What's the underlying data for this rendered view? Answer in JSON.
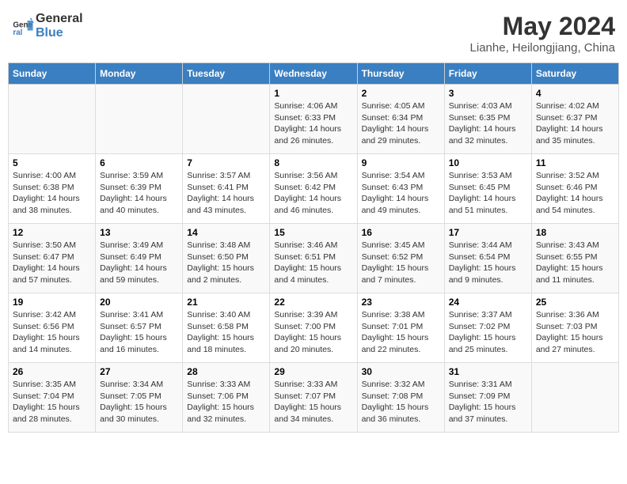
{
  "logo": {
    "line1": "General",
    "line2": "Blue"
  },
  "title": "May 2024",
  "subtitle": "Lianhe, Heilongjiang, China",
  "days_of_week": [
    "Sunday",
    "Monday",
    "Tuesday",
    "Wednesday",
    "Thursday",
    "Friday",
    "Saturday"
  ],
  "weeks": [
    [
      {
        "day": "",
        "info": ""
      },
      {
        "day": "",
        "info": ""
      },
      {
        "day": "",
        "info": ""
      },
      {
        "day": "1",
        "info": "Sunrise: 4:06 AM\nSunset: 6:33 PM\nDaylight: 14 hours\nand 26 minutes."
      },
      {
        "day": "2",
        "info": "Sunrise: 4:05 AM\nSunset: 6:34 PM\nDaylight: 14 hours\nand 29 minutes."
      },
      {
        "day": "3",
        "info": "Sunrise: 4:03 AM\nSunset: 6:35 PM\nDaylight: 14 hours\nand 32 minutes."
      },
      {
        "day": "4",
        "info": "Sunrise: 4:02 AM\nSunset: 6:37 PM\nDaylight: 14 hours\nand 35 minutes."
      }
    ],
    [
      {
        "day": "5",
        "info": "Sunrise: 4:00 AM\nSunset: 6:38 PM\nDaylight: 14 hours\nand 38 minutes."
      },
      {
        "day": "6",
        "info": "Sunrise: 3:59 AM\nSunset: 6:39 PM\nDaylight: 14 hours\nand 40 minutes."
      },
      {
        "day": "7",
        "info": "Sunrise: 3:57 AM\nSunset: 6:41 PM\nDaylight: 14 hours\nand 43 minutes."
      },
      {
        "day": "8",
        "info": "Sunrise: 3:56 AM\nSunset: 6:42 PM\nDaylight: 14 hours\nand 46 minutes."
      },
      {
        "day": "9",
        "info": "Sunrise: 3:54 AM\nSunset: 6:43 PM\nDaylight: 14 hours\nand 49 minutes."
      },
      {
        "day": "10",
        "info": "Sunrise: 3:53 AM\nSunset: 6:45 PM\nDaylight: 14 hours\nand 51 minutes."
      },
      {
        "day": "11",
        "info": "Sunrise: 3:52 AM\nSunset: 6:46 PM\nDaylight: 14 hours\nand 54 minutes."
      }
    ],
    [
      {
        "day": "12",
        "info": "Sunrise: 3:50 AM\nSunset: 6:47 PM\nDaylight: 14 hours\nand 57 minutes."
      },
      {
        "day": "13",
        "info": "Sunrise: 3:49 AM\nSunset: 6:49 PM\nDaylight: 14 hours\nand 59 minutes."
      },
      {
        "day": "14",
        "info": "Sunrise: 3:48 AM\nSunset: 6:50 PM\nDaylight: 15 hours\nand 2 minutes."
      },
      {
        "day": "15",
        "info": "Sunrise: 3:46 AM\nSunset: 6:51 PM\nDaylight: 15 hours\nand 4 minutes."
      },
      {
        "day": "16",
        "info": "Sunrise: 3:45 AM\nSunset: 6:52 PM\nDaylight: 15 hours\nand 7 minutes."
      },
      {
        "day": "17",
        "info": "Sunrise: 3:44 AM\nSunset: 6:54 PM\nDaylight: 15 hours\nand 9 minutes."
      },
      {
        "day": "18",
        "info": "Sunrise: 3:43 AM\nSunset: 6:55 PM\nDaylight: 15 hours\nand 11 minutes."
      }
    ],
    [
      {
        "day": "19",
        "info": "Sunrise: 3:42 AM\nSunset: 6:56 PM\nDaylight: 15 hours\nand 14 minutes."
      },
      {
        "day": "20",
        "info": "Sunrise: 3:41 AM\nSunset: 6:57 PM\nDaylight: 15 hours\nand 16 minutes."
      },
      {
        "day": "21",
        "info": "Sunrise: 3:40 AM\nSunset: 6:58 PM\nDaylight: 15 hours\nand 18 minutes."
      },
      {
        "day": "22",
        "info": "Sunrise: 3:39 AM\nSunset: 7:00 PM\nDaylight: 15 hours\nand 20 minutes."
      },
      {
        "day": "23",
        "info": "Sunrise: 3:38 AM\nSunset: 7:01 PM\nDaylight: 15 hours\nand 22 minutes."
      },
      {
        "day": "24",
        "info": "Sunrise: 3:37 AM\nSunset: 7:02 PM\nDaylight: 15 hours\nand 25 minutes."
      },
      {
        "day": "25",
        "info": "Sunrise: 3:36 AM\nSunset: 7:03 PM\nDaylight: 15 hours\nand 27 minutes."
      }
    ],
    [
      {
        "day": "26",
        "info": "Sunrise: 3:35 AM\nSunset: 7:04 PM\nDaylight: 15 hours\nand 28 minutes."
      },
      {
        "day": "27",
        "info": "Sunrise: 3:34 AM\nSunset: 7:05 PM\nDaylight: 15 hours\nand 30 minutes."
      },
      {
        "day": "28",
        "info": "Sunrise: 3:33 AM\nSunset: 7:06 PM\nDaylight: 15 hours\nand 32 minutes."
      },
      {
        "day": "29",
        "info": "Sunrise: 3:33 AM\nSunset: 7:07 PM\nDaylight: 15 hours\nand 34 minutes."
      },
      {
        "day": "30",
        "info": "Sunrise: 3:32 AM\nSunset: 7:08 PM\nDaylight: 15 hours\nand 36 minutes."
      },
      {
        "day": "31",
        "info": "Sunrise: 3:31 AM\nSunset: 7:09 PM\nDaylight: 15 hours\nand 37 minutes."
      },
      {
        "day": "",
        "info": ""
      }
    ]
  ]
}
